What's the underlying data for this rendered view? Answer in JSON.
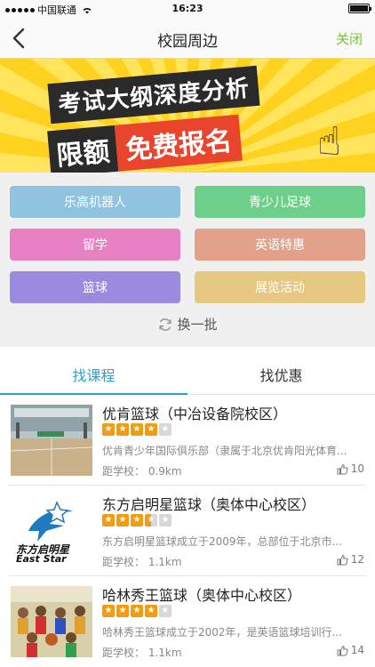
{
  "status_bar": {
    "carrier": "中国联通",
    "time": "16:23"
  },
  "nav": {
    "title": "校园周边",
    "close_label": "关闭"
  },
  "banner": {
    "line1": "考试大纲深度分析",
    "line2_prefix": "限额",
    "line2_highlight": "免费报名"
  },
  "tags": [
    {
      "label": "乐高机器人",
      "color": "#8fc3e0"
    },
    {
      "label": "青少儿足球",
      "color": "#6dd08a"
    },
    {
      "label": "留学",
      "color": "#e880c4"
    },
    {
      "label": "英语特惠",
      "color": "#e3a189"
    },
    {
      "label": "篮球",
      "color": "#9a8ae0"
    },
    {
      "label": "展览活动",
      "color": "#e6c882"
    }
  ],
  "refresh_label": "换一批",
  "tabs": [
    {
      "label": "找课程"
    },
    {
      "label": "找优惠"
    }
  ],
  "listings": [
    {
      "title": "优肯篮球（中冶设备院校区）",
      "rating": 4,
      "description": "优肯青少年国际俱乐部（隶属于北京优肯阳光体育...",
      "distance": "距学校： 0.9km",
      "likes": "10"
    },
    {
      "title": "东方启明星篮球（奥体中心校区）",
      "rating": 3.5,
      "description": "东方启明星篮球成立于2009年，总部位于北京市...",
      "distance": "距学校： 1.1km",
      "likes": "12",
      "logo_text": "东方启明星",
      "logo_sub": "East Star"
    },
    {
      "title": "哈林秀王篮球（奥体中心校区）",
      "rating": 4,
      "description": "哈林秀王篮球成立于2002年，是英语篮球培训行...",
      "distance": "距学校： 1.1km",
      "likes": "14"
    }
  ],
  "colors": {
    "accent": "#2aa0d6",
    "close": "#7ac23a",
    "star": "#f39c12"
  }
}
